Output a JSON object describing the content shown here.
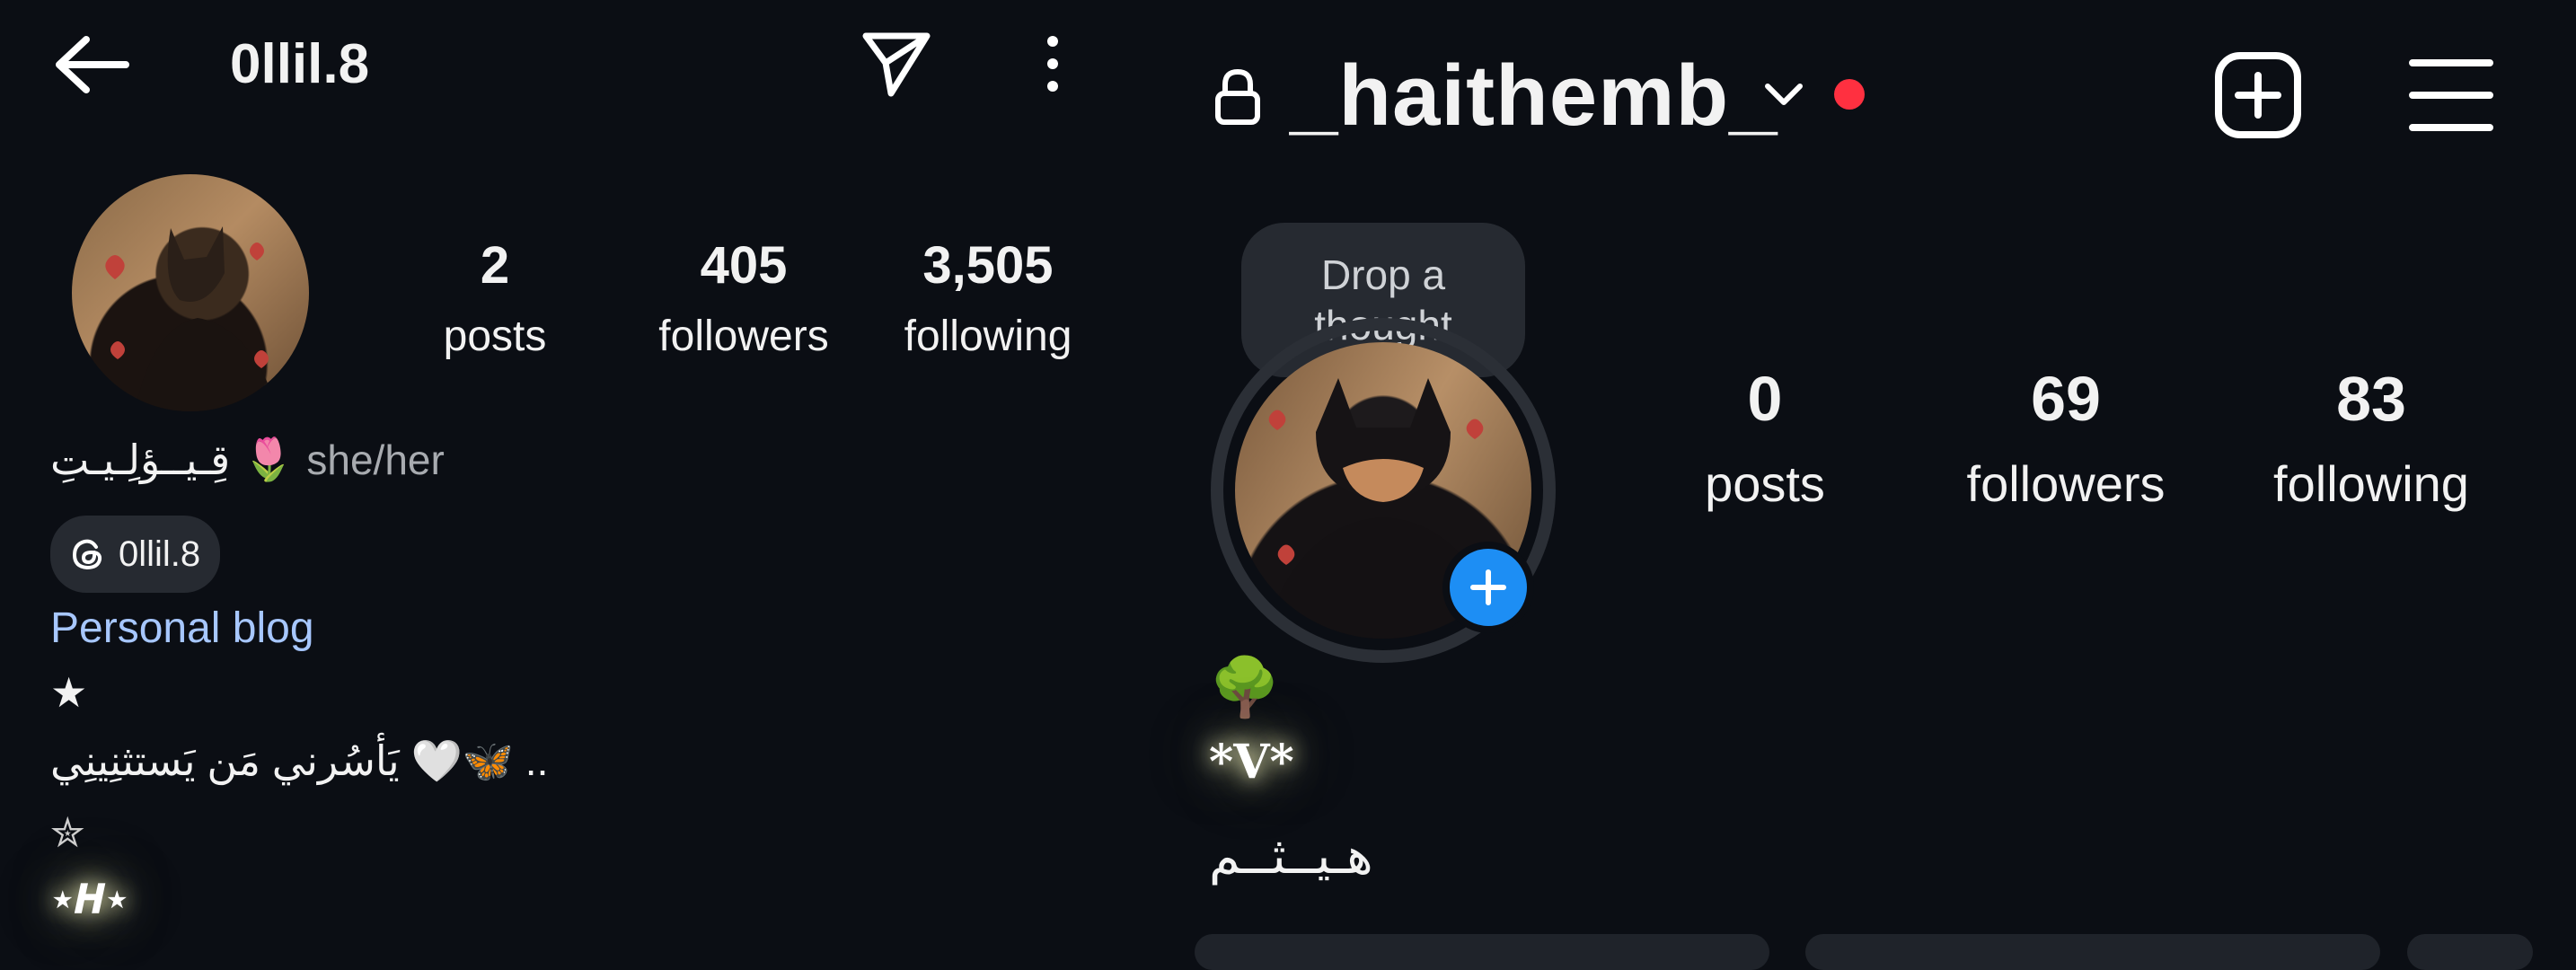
{
  "left_profile": {
    "username": "0llil.8",
    "stats": [
      {
        "value": "2",
        "label": "posts"
      },
      {
        "value": "405",
        "label": "followers"
      },
      {
        "value": "3,505",
        "label": "following"
      }
    ],
    "name_line": {
      "name": "قِـيــؤلِـيـتِ",
      "emoji": "🌷",
      "pronouns": "she/her"
    },
    "threads_badge": "0llil.8",
    "category": "Personal blog",
    "bio": [
      "★",
      ".. 🦋🤍 يَأسُرني مَن يَستثنِينِي",
      "✮",
      "⋆𝑯⋆"
    ]
  },
  "right_profile": {
    "username": "_haithemb_",
    "note_bubble": "Drop a thought",
    "stats": [
      {
        "value": "0",
        "label": "posts"
      },
      {
        "value": "69",
        "label": "followers"
      },
      {
        "value": "83",
        "label": "following"
      }
    ],
    "bio": {
      "emoji": "🌳",
      "glow_text": "*𝐕*",
      "arabic_name": "هـيــثــم"
    }
  },
  "colors": {
    "background": "#0b0e14",
    "link_blue": "#a7c7ff",
    "accent_blue": "#1d8ef4",
    "notification_red": "#ff3040",
    "pill_bg": "#262a31"
  },
  "icons": {
    "left_header": [
      "back-arrow-icon",
      "send-icon",
      "more-vertical-icon"
    ],
    "right_header": [
      "lock-icon",
      "chevron-down-icon",
      "create-plus-icon",
      "menu-icon"
    ],
    "badges": [
      "threads-icon",
      "add-story-plus-icon"
    ]
  }
}
